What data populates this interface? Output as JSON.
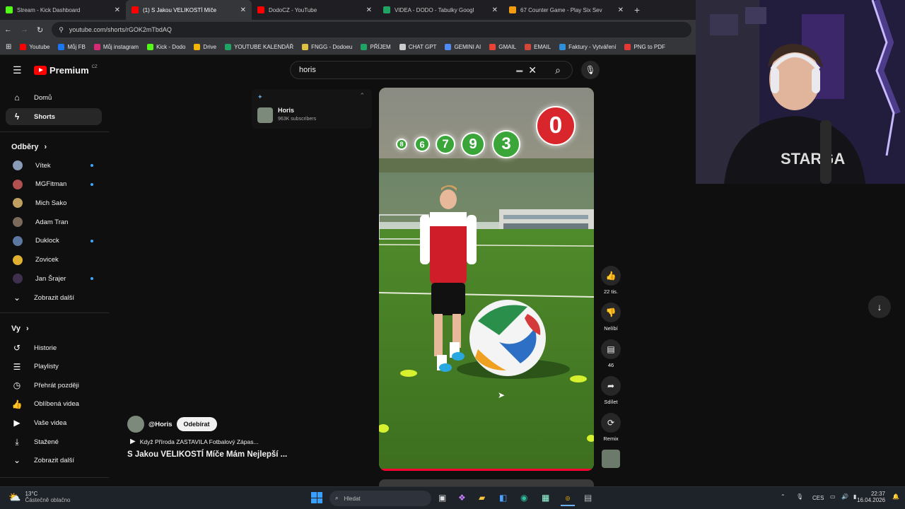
{
  "browser": {
    "tabs": [
      {
        "title": "Stream - Kick Dashboard",
        "icon": "kick-icon",
        "color": "#53fc18"
      },
      {
        "title": "(1) S Jakou VELIKOSTÍ Míče",
        "icon": "youtube-icon",
        "color": "#ff0000",
        "active": true
      },
      {
        "title": "DodoCZ - YouTube",
        "icon": "youtube-icon",
        "color": "#ff0000"
      },
      {
        "title": "VIDEA - DODO - Tabulky Googl",
        "icon": "sheets-icon",
        "color": "#1fa463"
      },
      {
        "title": "67 Counter Game - Play Six Sev",
        "icon": "game-icon",
        "color": "#f39c12"
      }
    ],
    "url": "youtube.com/shorts/rGOK2mTbdAQ",
    "bookmarks": [
      {
        "label": "Youtube",
        "color": "#ff0000"
      },
      {
        "label": "Můj FB",
        "color": "#1877f2"
      },
      {
        "label": "Můj instagram",
        "color": "#d62976"
      },
      {
        "label": "Kick - Dodo",
        "color": "#53fc18"
      },
      {
        "label": "Drive",
        "color": "#f4b400"
      },
      {
        "label": "YOUTUBE KALENDÁŘ",
        "color": "#1fa463"
      },
      {
        "label": "FNGG - Dodoeu",
        "color": "#e0c040"
      },
      {
        "label": "PŘÍJEM",
        "color": "#1fa463"
      },
      {
        "label": "CHAT GPT",
        "color": "#cccccc"
      },
      {
        "label": "GEMINI AI",
        "color": "#4f8cf7"
      },
      {
        "label": "GMAIL",
        "color": "#ea4335"
      },
      {
        "label": "EMAIL",
        "color": "#d44638"
      },
      {
        "label": "Faktury - Vytváření",
        "color": "#2f8fd8"
      },
      {
        "label": "PNG to PDF",
        "color": "#e53935"
      }
    ]
  },
  "header": {
    "logo": "Premium",
    "country": "CZ",
    "search_value": "horis"
  },
  "sidebar": {
    "main": [
      {
        "label": "Domů",
        "icon": "home-icon"
      },
      {
        "label": "Shorts",
        "icon": "shorts-icon"
      }
    ],
    "subs_title": "Odběry",
    "subs": [
      {
        "label": "Vítek",
        "color": "#8a9bb8",
        "dot": true
      },
      {
        "label": "MGFitman",
        "color": "#b05050",
        "dot": true
      },
      {
        "label": "Mich Sako",
        "color": "#c0a060",
        "dot": false
      },
      {
        "label": "Adam Tran",
        "color": "#7b6a5a",
        "dot": false
      },
      {
        "label": "Duklock",
        "color": "#5c78a0",
        "dot": true
      },
      {
        "label": "Zovicek",
        "color": "#e0b030",
        "dot": false
      },
      {
        "label": "Jan Šrajer",
        "color": "#403050",
        "dot": true
      }
    ],
    "show_more": "Zobrazit další",
    "you_title": "Vy",
    "you": [
      {
        "label": "Historie",
        "icon": "history-icon",
        "glyph": "↺"
      },
      {
        "label": "Playlisty",
        "icon": "playlist-icon",
        "glyph": "☰"
      },
      {
        "label": "Přehrát později",
        "icon": "clock-icon",
        "glyph": "◷"
      },
      {
        "label": "Oblíbená videa",
        "icon": "like-icon",
        "glyph": "👍"
      },
      {
        "label": "Vaše videa",
        "icon": "video-icon",
        "glyph": "▶"
      },
      {
        "label": "Stažené",
        "icon": "download-icon",
        "glyph": "⤓"
      }
    ],
    "show_more2": "Zobrazit další"
  },
  "channel_card": {
    "name": "Horis",
    "subscribers": "963K subscribers"
  },
  "video": {
    "numbers": [
      "8",
      "6",
      "7",
      "9",
      "3",
      "0"
    ],
    "channel": "@Horis",
    "subscribe": "Odebírat",
    "playlist": "Když Příroda ZASTAVILA Fotbalový Zápas...",
    "title": "S Jakou VELIKOSTÍ Míče Mám Nejlepší ..."
  },
  "actions": {
    "likes": "22 tis.",
    "dislike": "Nelíbí",
    "comments": "46",
    "share": "Sdílet",
    "remix": "Remix"
  },
  "taskbar": {
    "weather_temp": "13°C",
    "weather_desc": "Částečně oblačno",
    "search": "Hledat",
    "lang": "CES",
    "time": "22:37",
    "date": "16.04.2026"
  }
}
